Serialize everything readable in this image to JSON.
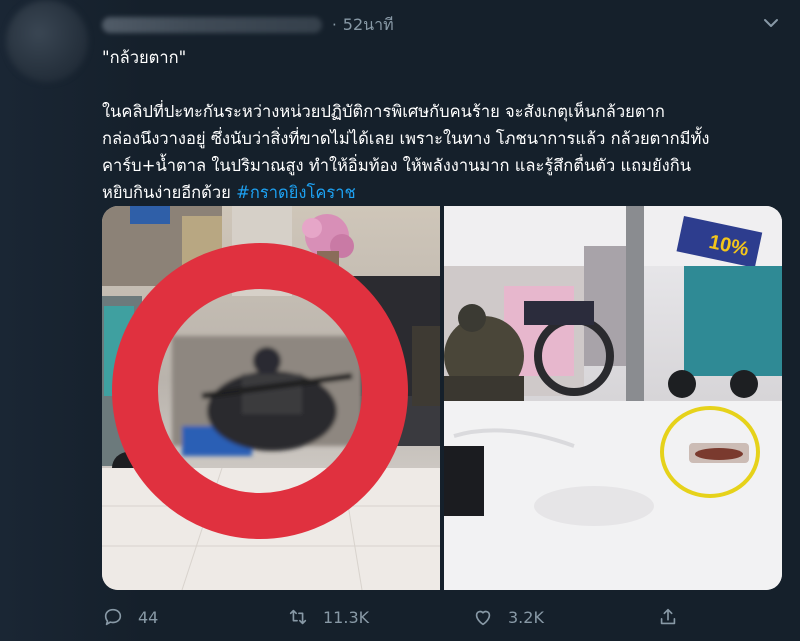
{
  "tweet": {
    "time": "52นาที",
    "dot": "·",
    "title_line": "\"กล้วยตาก\"",
    "paragraph": {
      "line1": "ในคลิปที่ปะทะกันระหว่างหน่วยปฏิบัติการพิเศษกับคนร้าย จะสังเกตุเห็นกล้วยตาก",
      "line2": "กล่องนึงวางอยู่ ซึ่งนับว่าสิ่งที่ขาดไม่ได้เลย เพราะในทาง โภชนาการแล้ว กล้วยตากมีทั้ง",
      "line3": "คาร์บ+น้ำตาล ในปริมาณสูง ทำให้อิ่มท้อง ให้พลังงานมาก และรู้สึกตื่นตัว แถมยังกิน",
      "line4_prefix": "หยิบกินง่ายอีกด้วย ",
      "hashtag": "#กราดยิงโคราช"
    },
    "photo_right_sign": "10%"
  },
  "actions": {
    "reply_count": "44",
    "retweet_count": "11.3K",
    "like_count": "3.2K"
  },
  "icons": {
    "chevron": "chevron-down-icon",
    "reply": "reply-icon",
    "retweet": "retweet-icon",
    "like": "heart-icon",
    "share": "share-icon"
  },
  "colors": {
    "background": "#15202b",
    "muted_text": "#8899a6",
    "hashtag": "#1da1f2",
    "red_circle": "#e0313f",
    "yellow_circle": "#e6d21a"
  }
}
